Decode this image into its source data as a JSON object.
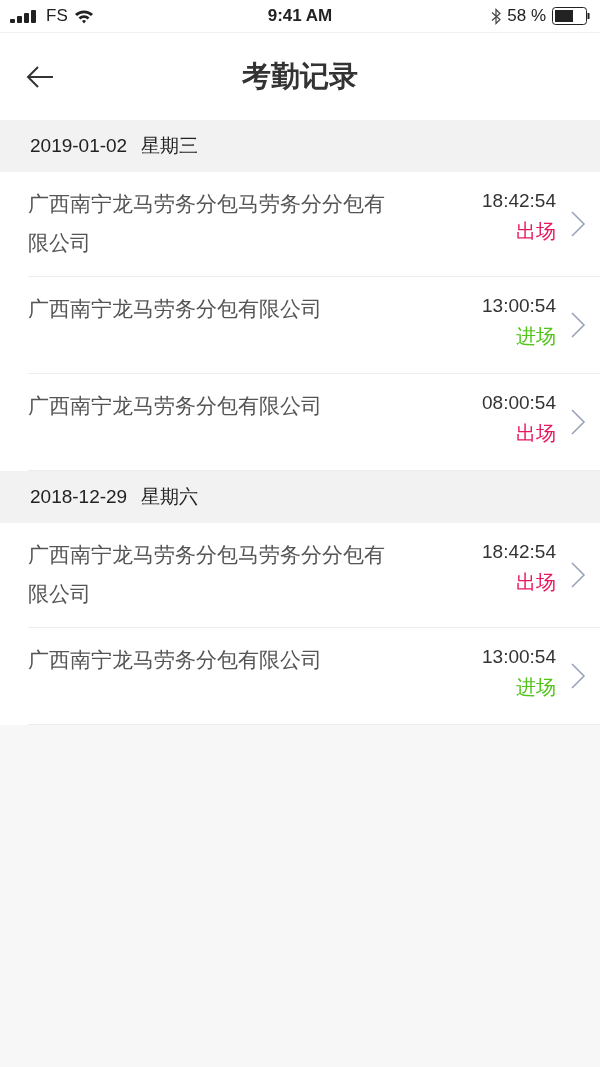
{
  "status_bar": {
    "carrier": "FS",
    "time": "9:41 AM",
    "battery": "58 %"
  },
  "header": {
    "title": "考勤记录"
  },
  "groups": [
    {
      "date": "2019-01-02",
      "weekday": "星期三",
      "records": [
        {
          "company": "广西南宁龙马劳务分包马劳务分分包有限公司",
          "time": "18:42:54",
          "status": "出场",
          "color": "#e8185f"
        },
        {
          "company": "广西南宁龙马劳务分包有限公司",
          "time": "13:00:54",
          "status": "进场",
          "color": "#52c41a"
        },
        {
          "company": "广西南宁龙马劳务分包有限公司",
          "time": "08:00:54",
          "status": "出场",
          "color": "#e8185f"
        }
      ]
    },
    {
      "date": "2018-12-29",
      "weekday": "星期六",
      "records": [
        {
          "company": "广西南宁龙马劳务分包马劳务分分包有限公司",
          "time": "18:42:54",
          "status": "出场",
          "color": "#e8185f"
        },
        {
          "company": "广西南宁龙马劳务分包有限公司",
          "time": "13:00:54",
          "status": "进场",
          "color": "#52c41a"
        }
      ]
    }
  ]
}
